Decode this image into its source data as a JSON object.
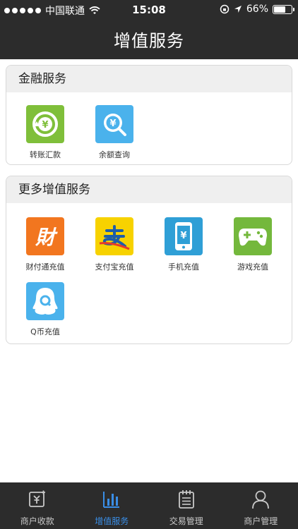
{
  "status_bar": {
    "carrier": "中国联通",
    "time": "15:08",
    "battery": "66%",
    "battery_level": 0.66
  },
  "nav": {
    "title": "增值服务"
  },
  "sections": [
    {
      "title": "金融服务",
      "items": [
        {
          "label": "转账汇款",
          "icon": "transfer-icon",
          "color": "#7fbf3a"
        },
        {
          "label": "余额查询",
          "icon": "balance-query-icon",
          "color": "#4ab2ec"
        }
      ]
    },
    {
      "title": "更多增值服务",
      "items": [
        {
          "label": "财付通充值",
          "icon": "tenpay-icon",
          "color": "#f2761f"
        },
        {
          "label": "支付宝充值",
          "icon": "alipay-icon",
          "color": "#f7d200"
        },
        {
          "label": "手机充值",
          "icon": "mobile-recharge-icon",
          "color": "#2f9fd6"
        },
        {
          "label": "游戏充值",
          "icon": "gamepad-icon",
          "color": "#74b83c"
        },
        {
          "label": "Q币充值",
          "icon": "qq-coin-icon",
          "color": "#4ab2ec"
        }
      ]
    }
  ],
  "tabbar": {
    "tabs": [
      {
        "label": "商户收款",
        "icon": "receive-payment-icon"
      },
      {
        "label": "增值服务",
        "icon": "bar-chart-icon",
        "active": true
      },
      {
        "label": "交易管理",
        "icon": "clipboard-icon"
      },
      {
        "label": "商户管理",
        "icon": "user-icon"
      }
    ],
    "active_color": "#3a8ee6"
  },
  "colors": {
    "bar_bg": "#2c2c2c",
    "section_header_bg": "#efefef"
  }
}
